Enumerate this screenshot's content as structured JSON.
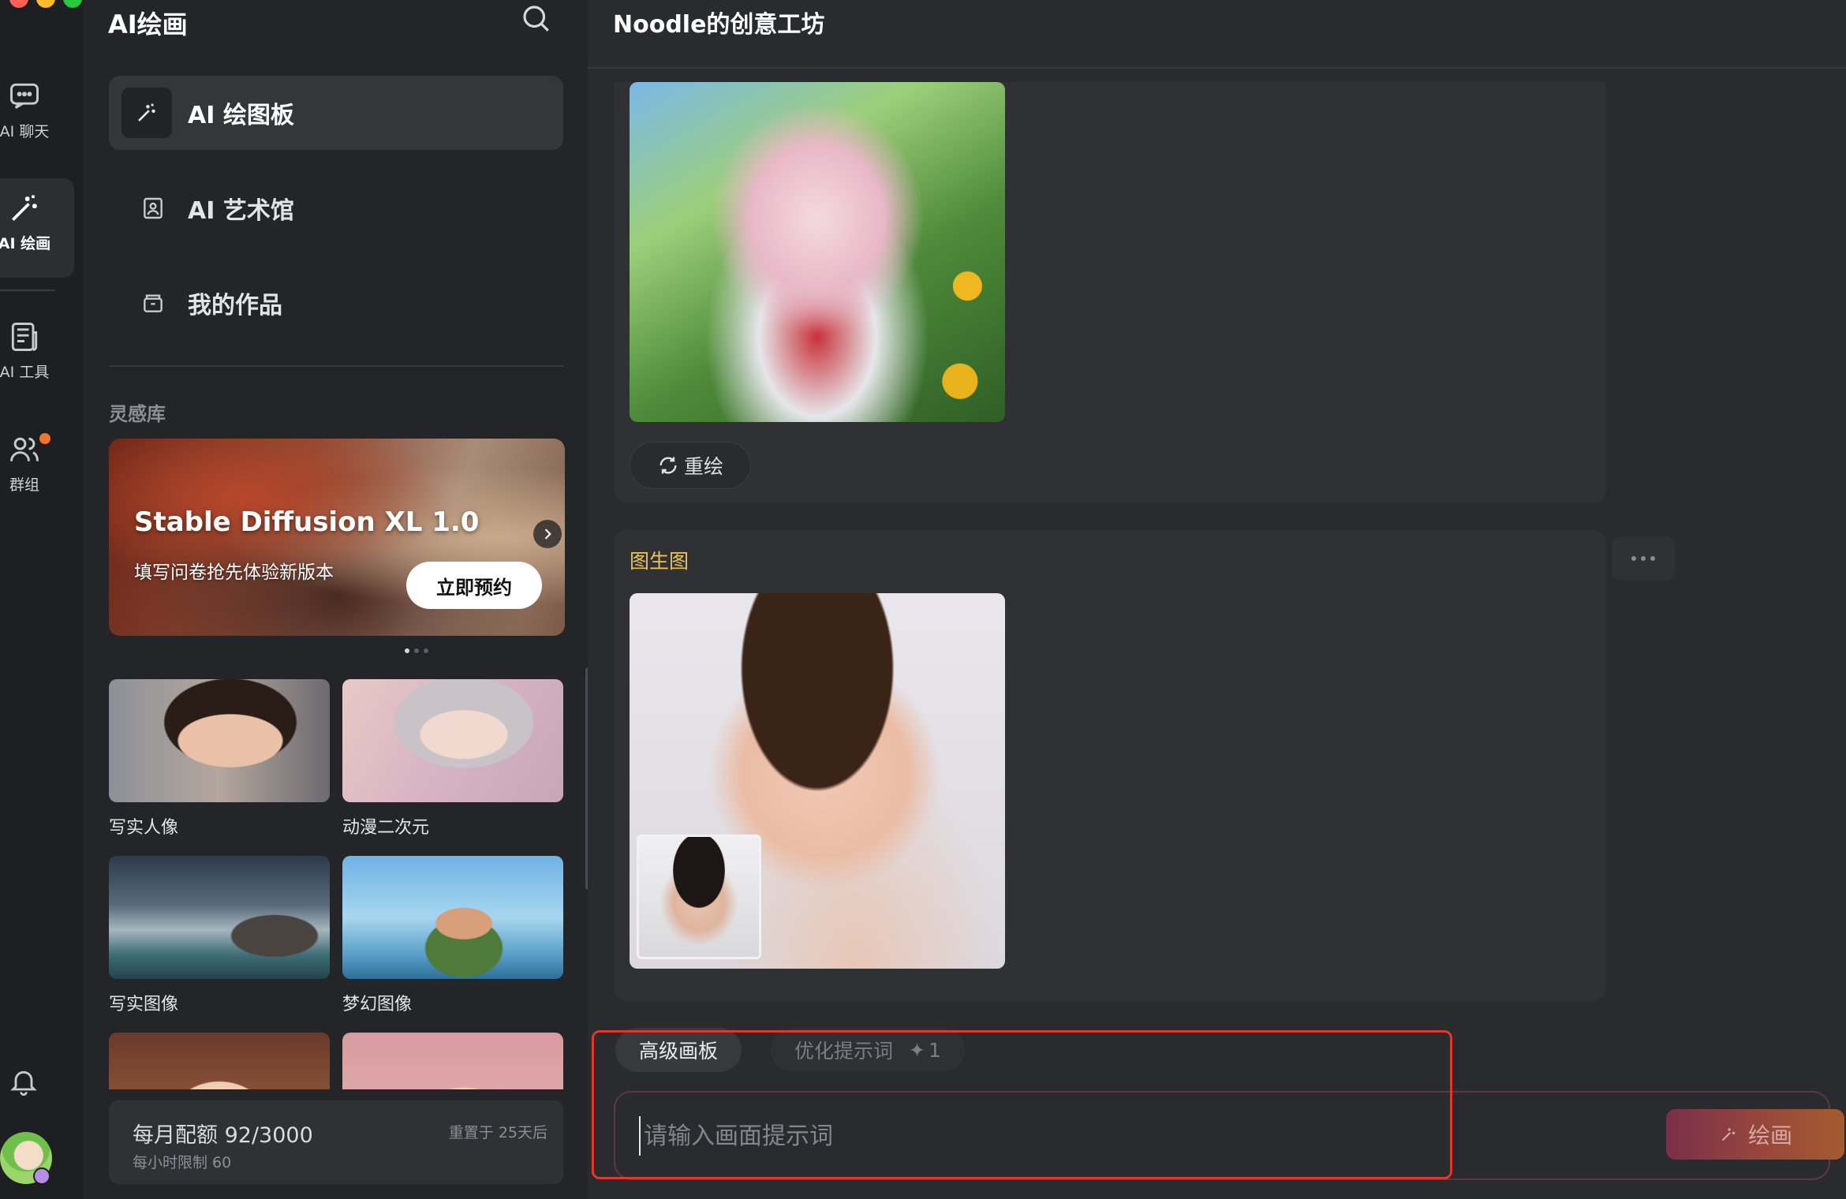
{
  "rail": {
    "items": [
      {
        "label": "AI 聊天",
        "icon": "chat-bubble-icon"
      },
      {
        "label": "AI 绘画",
        "icon": "magic-wand-icon",
        "active": true
      },
      {
        "label": "AI 工具",
        "icon": "document-icon"
      },
      {
        "label": "群组",
        "icon": "users-icon",
        "badge": true
      }
    ],
    "bottom": {
      "bell_icon": "bell-icon",
      "avatar": "user-avatar"
    },
    "colors": {
      "traffic_red": "#fe5f57",
      "traffic_yellow": "#febc2e",
      "traffic_green": "#28c840",
      "badge": "#f0762e"
    }
  },
  "sidebar": {
    "title": "AI绘画",
    "search_icon": "search-icon",
    "nav": [
      {
        "label": "AI 绘图板",
        "icon": "magic-wand-icon",
        "active": true
      },
      {
        "label": "AI 艺术馆",
        "icon": "image-icon"
      },
      {
        "label": "我的作品",
        "icon": "archive-box-icon"
      }
    ],
    "section_label": "灵感库",
    "banner": {
      "title": "Stable Diffusion XL 1.0",
      "subtitle": "填写问卷抢先体验新版本",
      "button": "立即预约",
      "pager": {
        "count": 3,
        "current": 1
      }
    },
    "tiles": [
      {
        "caption": "写实人像"
      },
      {
        "caption": "动漫二次元"
      },
      {
        "caption": "写实图像"
      },
      {
        "caption": "梦幻图像"
      },
      {
        "caption": ""
      },
      {
        "caption": ""
      }
    ],
    "quota": {
      "main": "每月配额 92/3000",
      "reset": "重置于 25天后",
      "hourly": "每小时限制 60"
    }
  },
  "main": {
    "title": "Noodle的创意工坊",
    "cards": [
      {
        "redraw_label": "重绘"
      },
      {
        "tag": "图生图"
      }
    ],
    "composer": {
      "tabs": [
        {
          "label": "高级画板",
          "active": true
        },
        {
          "label": "优化提示词",
          "count": "1"
        }
      ],
      "placeholder": "请输入画面提示词",
      "draw_label": "绘画"
    },
    "accent_colors": {
      "tag": "#e8c35c",
      "annotation_box": "#e3362d"
    }
  }
}
